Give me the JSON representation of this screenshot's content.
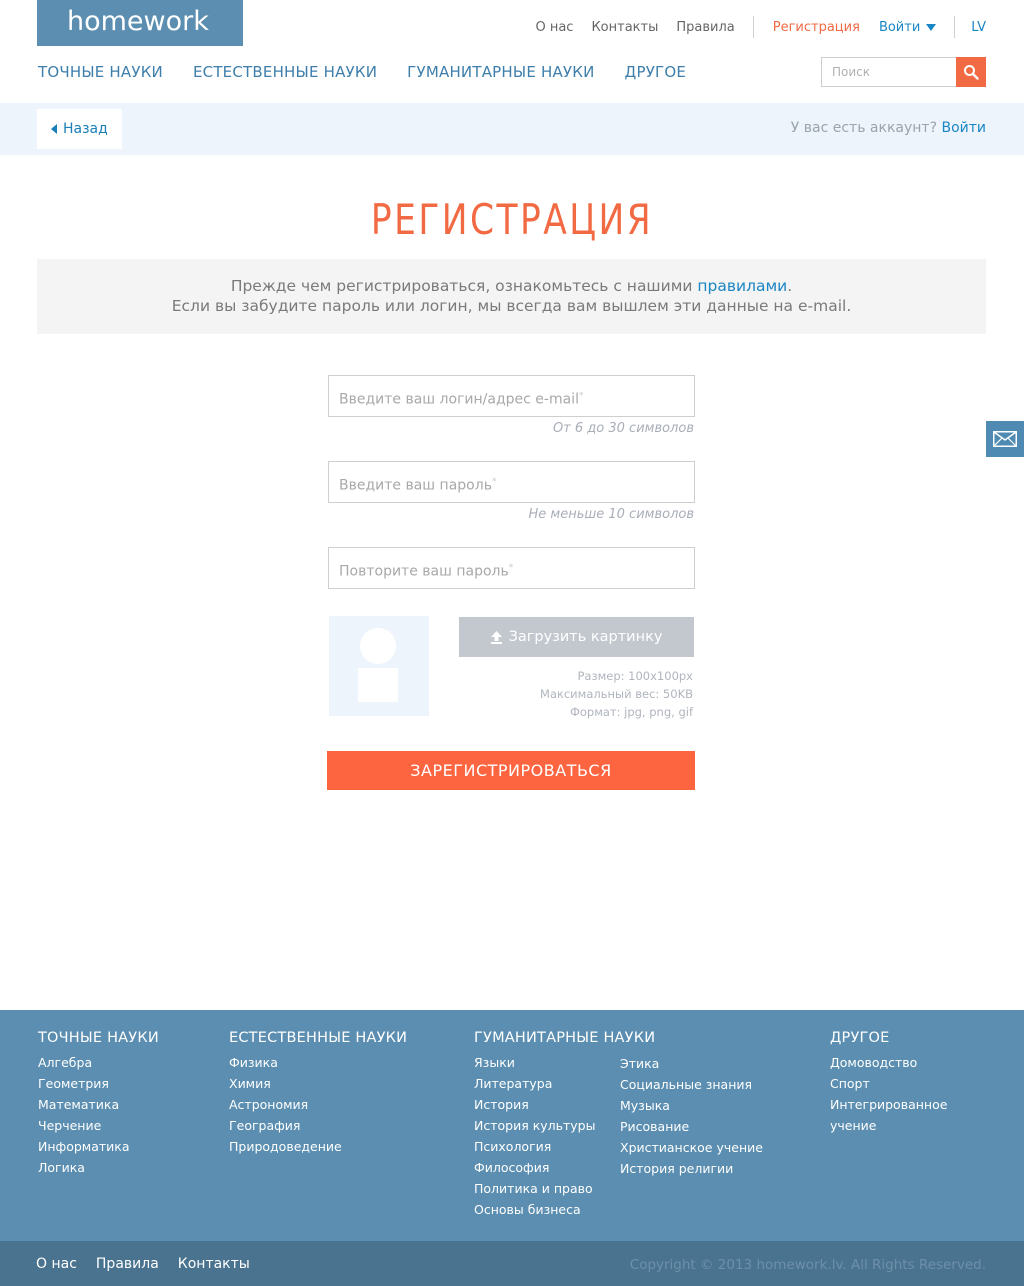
{
  "header": {
    "logo": "homework",
    "top_links": {
      "about": "О нас",
      "contacts": "Контакты",
      "rules": "Правила",
      "register": "Регистрация",
      "login": "Войти",
      "lang": "LV"
    },
    "nav": [
      "ТОЧНЫЕ НАУКИ",
      "ЕСТЕСТВЕННЫЕ НАУКИ",
      "ГУМАНИТАРНЫЕ НАУКИ",
      "ДРУГОЕ"
    ],
    "search_placeholder": "Поиск"
  },
  "subbar": {
    "back": "Назад",
    "has_account": "У вас есть аккаунт?",
    "login_link": "Войти"
  },
  "page": {
    "title": "РЕГИСТРАЦИЯ",
    "notice_line1_pre": "Прежде чем регистрироваться, ознакомьтесь с нашими ",
    "notice_rules_link": "правилами",
    "notice_line1_post": ".",
    "notice_line2": "Если вы забудите пароль или логин, мы всегда вам вышлем эти данные на e-mail."
  },
  "form": {
    "login_placeholder": "Введите ваш логин/адрес e-mail",
    "login_hint": "От 6 до 30 символов",
    "password_placeholder": "Введите ваш пароль",
    "password_hint": "Не меньше 10 символов",
    "repeat_placeholder": "Повторите ваш пароль",
    "required_mark": "*",
    "upload_label": "Загрузить картинку",
    "spec_size": "Размер: 100x100px",
    "spec_weight": "Максимальный вес: 50KB",
    "spec_format": "Формат: jpg, png, gif",
    "submit": "ЗАРЕГИСТРИРОВАТЬСЯ"
  },
  "footer": {
    "exact": {
      "title": "ТОЧНЫЕ НАУКИ",
      "items": [
        "Алгебра",
        "Геометрия",
        "Математика",
        "Черчение",
        "Информатика",
        "Логика"
      ]
    },
    "natural": {
      "title": "ЕСТЕСТВЕННЫЕ НАУКИ",
      "items": [
        "Физика",
        "Химия",
        "Астрономия",
        "География",
        "Природоведение"
      ]
    },
    "humanities": {
      "title": "ГУМАНИТАРНЫЕ НАУКИ",
      "items_a": [
        "Языки",
        "Литература",
        "История",
        "История культуры",
        "Психология",
        "Философия",
        "Политика и право",
        "Основы бизнеса"
      ],
      "items_b": [
        "Этика",
        "Социальные знания",
        "Музыка",
        "Рисование",
        "Христианское учение",
        "История религии"
      ]
    },
    "other": {
      "title": "ДРУГОЕ",
      "items": [
        "Домоводство",
        "Спорт",
        "Интегрированное",
        "учение"
      ]
    },
    "bottom_links": [
      "О нас",
      "Правила",
      "Контакты"
    ],
    "copyright": "Copyright © 2013 homework.lv. All Rights Reserved."
  },
  "icons": {
    "search": "search-icon",
    "mail": "mail-icon",
    "upload": "upload-icon",
    "back": "back-arrow-icon",
    "dropdown": "dropdown-arrow-icon"
  },
  "colors": {
    "brand": "#5b8eb0",
    "accent": "#f26a43",
    "link": "#1a86c4",
    "footer_bar": "#4a7390"
  }
}
